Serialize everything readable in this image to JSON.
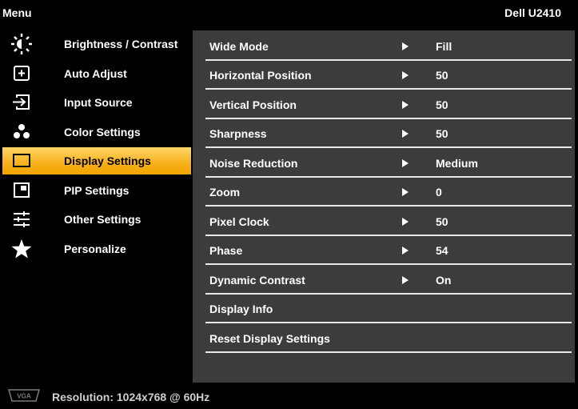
{
  "header": {
    "menu_title": "Menu",
    "model": "Dell U2410"
  },
  "sidebar": {
    "items": [
      {
        "label": "Brightness / Contrast",
        "icon": "brightness-icon",
        "active": false
      },
      {
        "label": "Auto Adjust",
        "icon": "auto-adjust-icon",
        "active": false
      },
      {
        "label": "Input Source",
        "icon": "input-source-icon",
        "active": false
      },
      {
        "label": "Color Settings",
        "icon": "color-settings-icon",
        "active": false
      },
      {
        "label": "Display Settings",
        "icon": "display-settings-icon",
        "active": true
      },
      {
        "label": "PIP Settings",
        "icon": "pip-icon",
        "active": false
      },
      {
        "label": "Other Settings",
        "icon": "other-settings-icon",
        "active": false
      },
      {
        "label": "Personalize",
        "icon": "star-icon",
        "active": false
      }
    ]
  },
  "panel": {
    "rows": [
      {
        "label": "Wide Mode",
        "value": "Fill",
        "has_arrow": true
      },
      {
        "label": "Horizontal Position",
        "value": "50",
        "has_arrow": true
      },
      {
        "label": "Vertical Position",
        "value": "50",
        "has_arrow": true
      },
      {
        "label": "Sharpness",
        "value": "50",
        "has_arrow": true
      },
      {
        "label": "Noise Reduction",
        "value": "Medium",
        "has_arrow": true
      },
      {
        "label": "Zoom",
        "value": "0",
        "has_arrow": true
      },
      {
        "label": "Pixel Clock",
        "value": "50",
        "has_arrow": true
      },
      {
        "label": "Phase",
        "value": "54",
        "has_arrow": true
      },
      {
        "label": "Dynamic Contrast",
        "value": "On",
        "has_arrow": true
      },
      {
        "label": "Display Info",
        "value": "",
        "has_arrow": false
      },
      {
        "label": "Reset Display Settings",
        "value": "",
        "has_arrow": false
      }
    ]
  },
  "status": {
    "icon": "vga-connector-icon",
    "text": "Resolution: 1024x768 @ 60Hz"
  },
  "colors": {
    "panel_bg": "#3c3c3c",
    "highlight": "#f7b01a",
    "background": "#000000"
  }
}
